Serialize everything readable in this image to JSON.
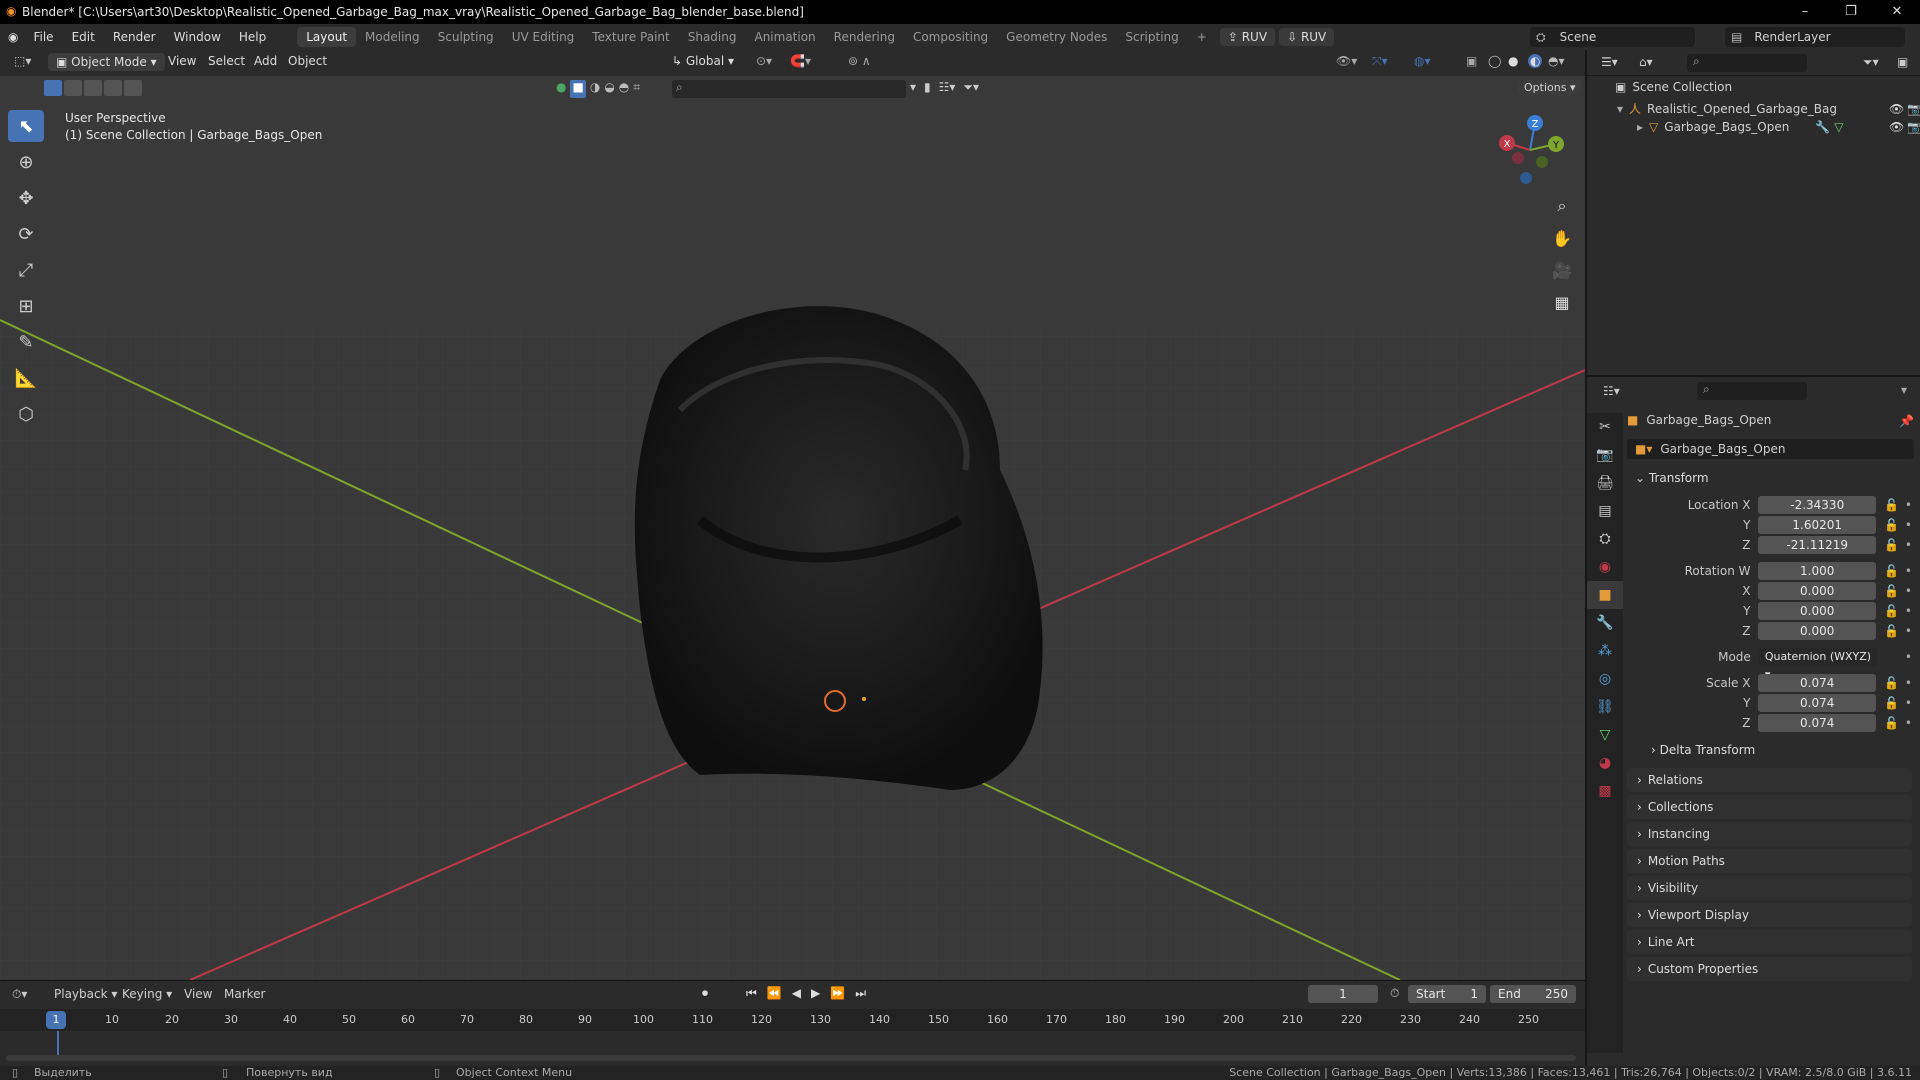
{
  "titlebar": {
    "title": "Blender* [C:\\Users\\art30\\Desktop\\Realistic_Opened_Garbage_Bag_max_vray\\Realistic_Opened_Garbage_Bag_blender_base.blend]"
  },
  "menu": [
    "File",
    "Edit",
    "Render",
    "Window",
    "Help"
  ],
  "workspaces": [
    "Layout",
    "Modeling",
    "Sculpting",
    "UV Editing",
    "Texture Paint",
    "Shading",
    "Animation",
    "Rendering",
    "Compositing",
    "Geometry Nodes",
    "Scripting"
  ],
  "ruv_buttons": [
    "RUV",
    "RUV"
  ],
  "scene": {
    "name": "Scene",
    "renderlayer": "RenderLayer"
  },
  "vp_header": {
    "mode": "Object Mode",
    "menus": [
      "View",
      "Select",
      "Add",
      "Object"
    ],
    "orientation": "Global",
    "options": "Options"
  },
  "viewport": {
    "perspective": "User Perspective",
    "collection": "(1) Scene Collection | Garbage_Bags_Open"
  },
  "gizmo": {
    "z": "Z",
    "y": "Y",
    "x": "X"
  },
  "outliner": {
    "root": "Scene Collection",
    "items": [
      "Realistic_Opened_Garbage_Bag",
      "Garbage_Bags_Open"
    ]
  },
  "properties": {
    "object_name": "Garbage_Bags_Open",
    "datablock": "Garbage_Bags_Open",
    "transform_label": "Transform",
    "location": {
      "label": "Location X",
      "x": "-2.34330",
      "y": "1.60201",
      "z": "-21.11219"
    },
    "rotation": {
      "label": "Rotation W",
      "w": "1.000",
      "x": "0.000",
      "y": "0.000",
      "z": "0.000"
    },
    "mode": {
      "label": "Mode",
      "value": "Quaternion (WXYZ)"
    },
    "scale": {
      "label": "Scale X",
      "x": "0.074",
      "y": "0.074",
      "z": "0.074"
    },
    "axis": {
      "y": "Y",
      "z": "Z",
      "x": "X"
    },
    "subpanels": [
      "Delta Transform",
      "Relations",
      "Collections",
      "Instancing",
      "Motion Paths",
      "Visibility",
      "Viewport Display",
      "Line Art",
      "Custom Properties"
    ]
  },
  "timeline": {
    "menus": [
      "Playback",
      "Keying",
      "View",
      "Marker"
    ],
    "current_frame": "1",
    "start_label": "Start",
    "start": "1",
    "end_label": "End",
    "end": "250",
    "ticks": [
      "10",
      "20",
      "30",
      "40",
      "50",
      "60",
      "70",
      "80",
      "90",
      "100",
      "110",
      "120",
      "130",
      "140",
      "150",
      "160",
      "170",
      "180",
      "190",
      "200",
      "210",
      "220",
      "230",
      "240",
      "250"
    ],
    "playhead": "1"
  },
  "status": {
    "left1": "Выделить",
    "left2": "Повернуть вид",
    "left3": "Object Context Menu",
    "right": "Scene Collection | Garbage_Bags_Open | Verts:13,386 | Faces:13,461 | Tris:26,764 | Objects:0/2 | VRAM: 2.5/8.0 GiB | 3.6.11"
  },
  "colors": {
    "accent": "#4772b3",
    "x_axis": "#c0394a",
    "y_axis": "#7fa52a",
    "z_axis": "#3a7fd6"
  }
}
